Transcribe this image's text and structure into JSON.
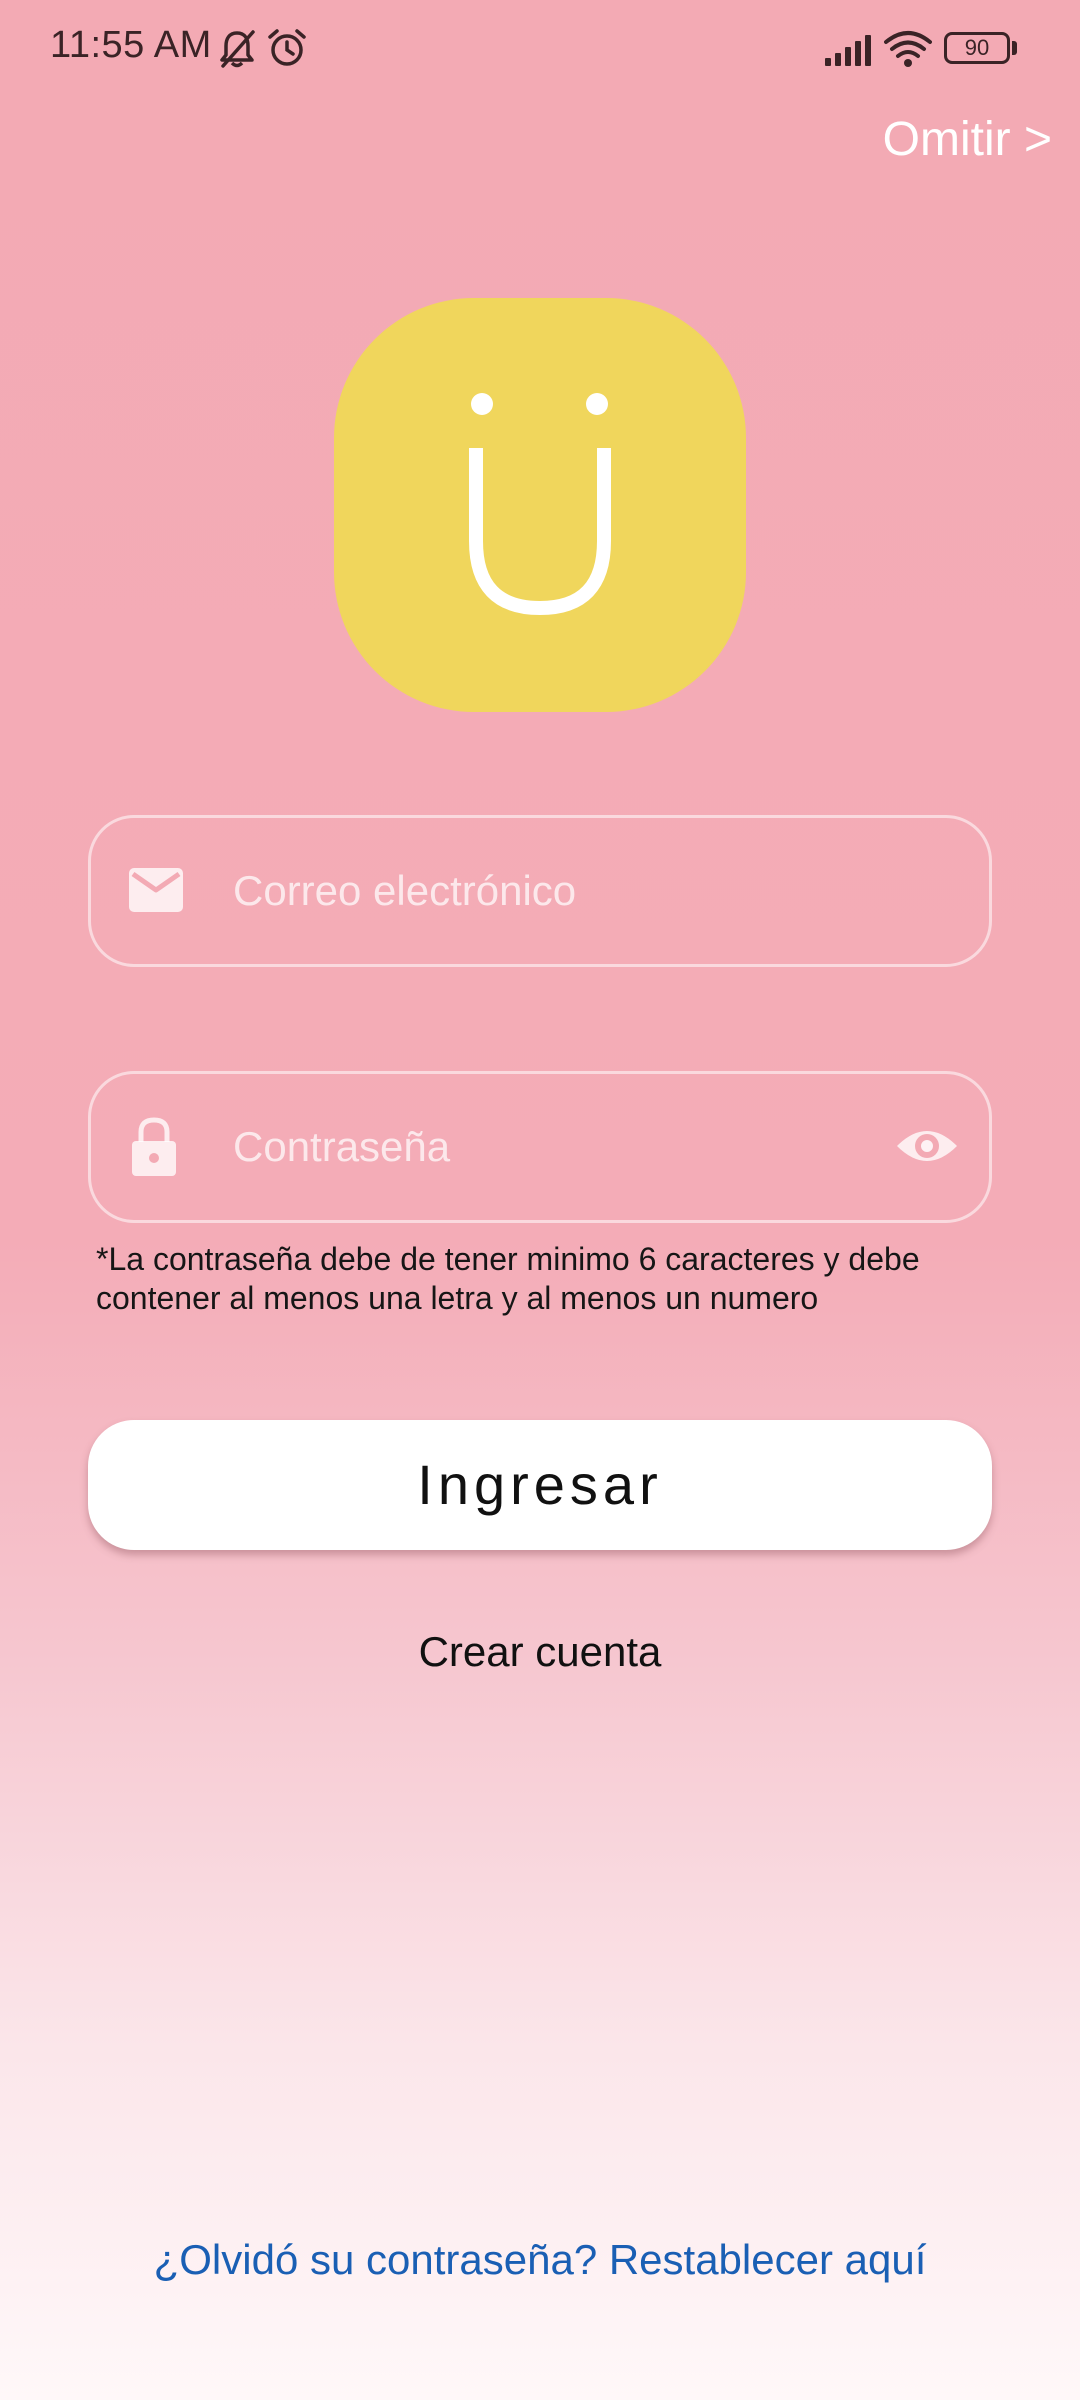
{
  "status_bar": {
    "time": "11:55 AM",
    "battery_level": "90",
    "icons": [
      "bell-muted-icon",
      "alarm-icon",
      "signal-icon",
      "wifi-icon",
      "battery-icon"
    ]
  },
  "header": {
    "skip_label": "Omitir >"
  },
  "logo": {
    "letter": "U",
    "background_color": "#f0d65c"
  },
  "form": {
    "email": {
      "placeholder": "Correo electrónico",
      "value": "",
      "icon": "email-icon"
    },
    "password": {
      "placeholder": "Contraseña",
      "value": "",
      "icon": "lock-icon",
      "toggle_icon": "eye-icon"
    },
    "password_hint": "*La contraseña debe de tener minimo 6 caracteres y debe contener al menos una letra y al menos un numero",
    "submit_label": "Ingresar",
    "create_account_label": "Crear cuenta",
    "forgot_password_label": "¿Olvidó su contraseña? Restablecer aquí"
  },
  "colors": {
    "background_top": "#f3aab4",
    "background_bottom": "#fff8f9",
    "link": "#1a5fb4",
    "logo": "#f0d65c"
  }
}
